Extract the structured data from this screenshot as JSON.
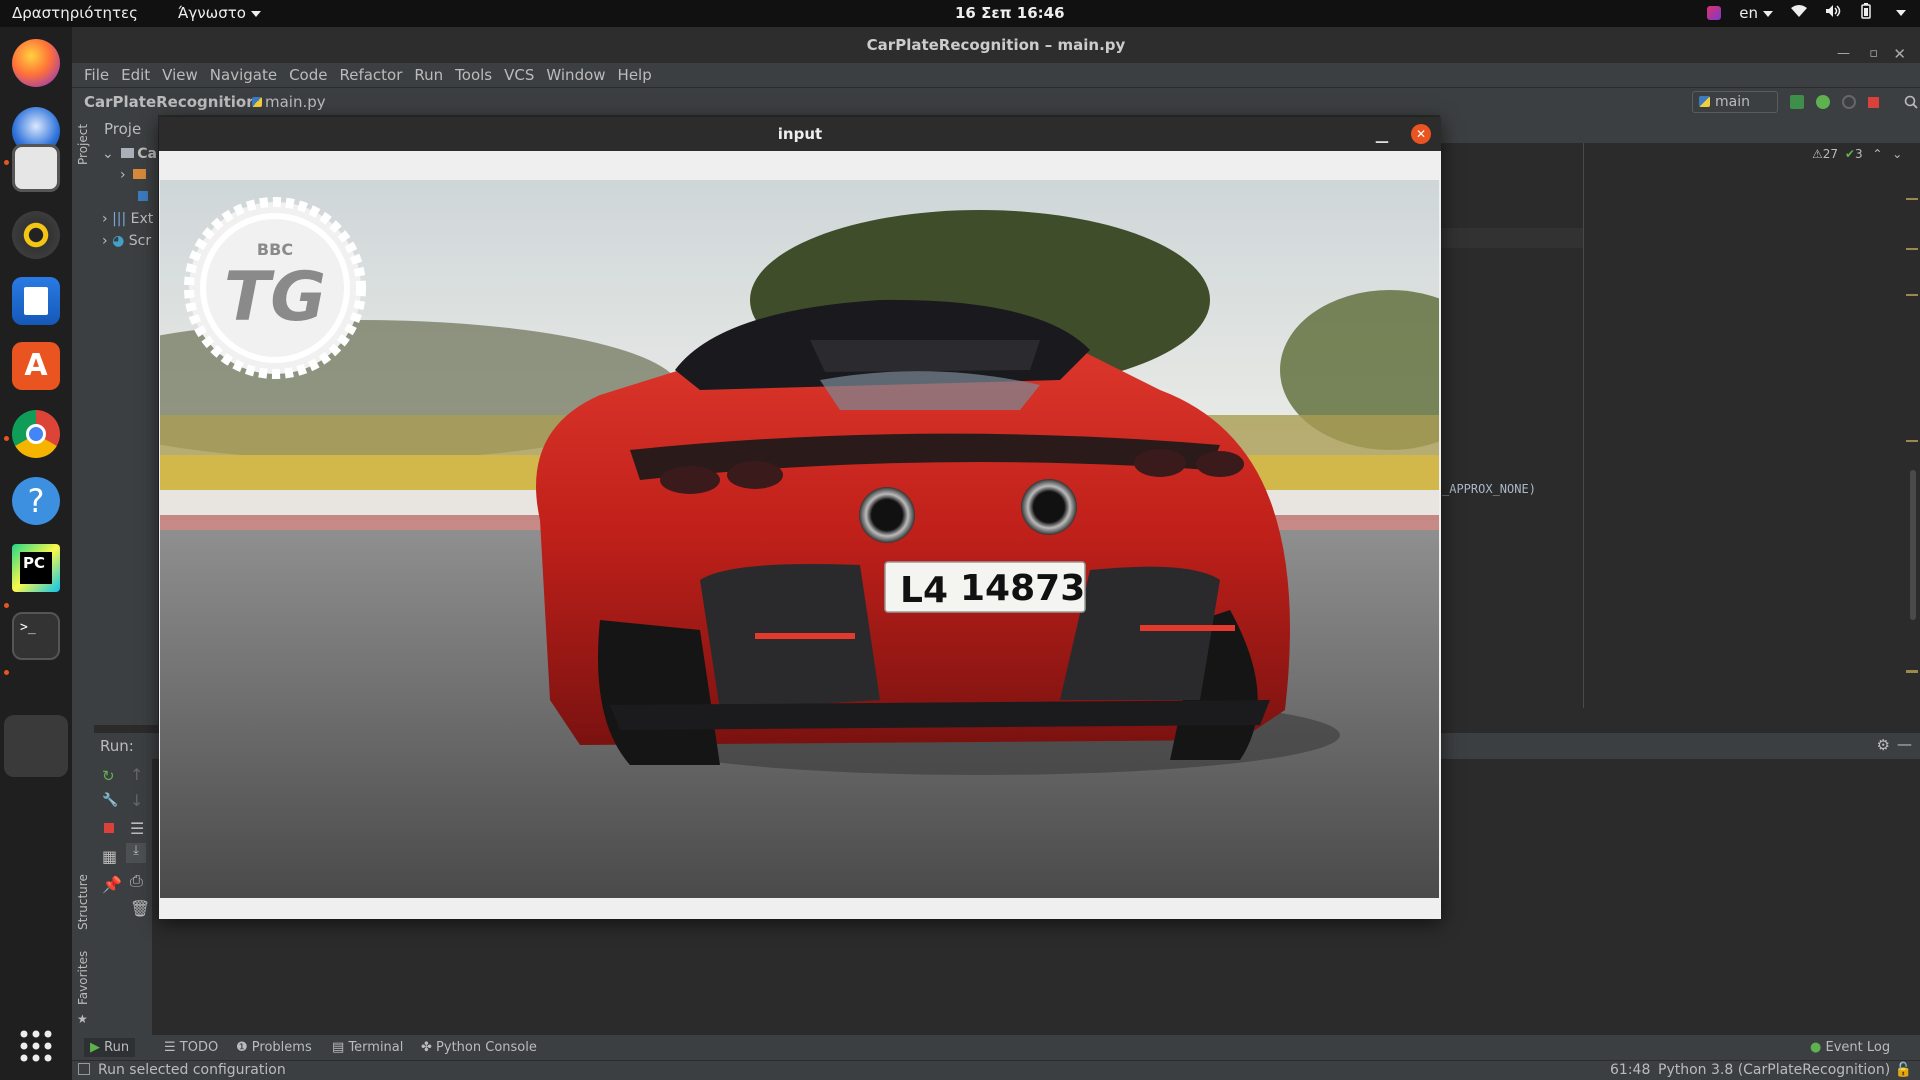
{
  "topbar": {
    "activities": "Δραστηριότητες",
    "app_menu": "Άγνωστο",
    "clock": "16 Σεπ  16:46",
    "lang": "en"
  },
  "window": {
    "title": "CarPlateRecognition – main.py"
  },
  "menu": [
    "File",
    "Edit",
    "View",
    "Navigate",
    "Code",
    "Refactor",
    "Run",
    "Tools",
    "VCS",
    "Window",
    "Help"
  ],
  "nav": {
    "project": "CarPlateRecognition",
    "file": "main.py",
    "run_config": "main"
  },
  "project_panel": {
    "header": "Proje",
    "root": "Ca",
    "ext": "Ext",
    "scratch": "Scr",
    "vertical_label": "Project"
  },
  "editor": {
    "code_fragment": "_APPROX_NONE)",
    "warnings": "27",
    "checks": "3"
  },
  "run_panel": {
    "label": "Run:"
  },
  "side_labels": {
    "structure": "Structure",
    "favorites": "Favorites"
  },
  "bottom_tabs": [
    "Run",
    "TODO",
    "Problems",
    "Terminal",
    "Python Console"
  ],
  "event_log": "Event Log",
  "status": {
    "message": "Run selected configuration",
    "position": "61:48",
    "interpreter": "Python 3.8 (CarPlateRecognition)"
  },
  "cv_window": {
    "title": "input",
    "logo_small": "BBC",
    "logo_big": "TG",
    "plate_prefix": "L4",
    "plate_number": "14873"
  },
  "colors": {
    "accent": "#e95420",
    "ide_bg": "#2b2b2b",
    "ide_panel": "#3c3f41",
    "car_red": "#c0201a"
  }
}
